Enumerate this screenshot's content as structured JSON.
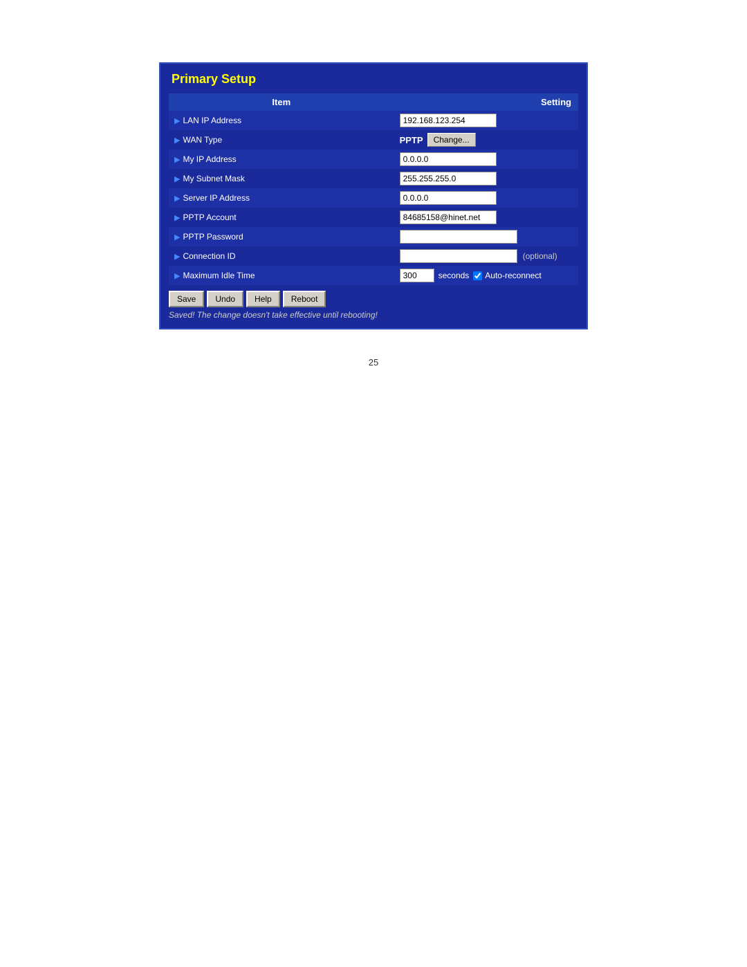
{
  "panel": {
    "title": "Primary Setup",
    "header": {
      "item_label": "Item",
      "setting_label": "Setting"
    },
    "rows": [
      {
        "label": "LAN IP Address",
        "arrow": "▶",
        "type": "input",
        "value": "192.168.123.254"
      },
      {
        "label": "WAN Type",
        "arrow": "▶",
        "type": "wan",
        "wan_value": "PPTP",
        "change_label": "Change..."
      },
      {
        "label": "My IP Address",
        "arrow": "▶",
        "type": "input",
        "value": "0.0.0.0"
      },
      {
        "label": "My Subnet Mask",
        "arrow": "▶",
        "type": "input",
        "value": "255.255.255.0"
      },
      {
        "label": "Server IP Address",
        "arrow": "▶",
        "type": "input",
        "value": "0.0.0.0"
      },
      {
        "label": "PPTP Account",
        "arrow": "▶",
        "type": "input",
        "value": "84685158@hinet.net"
      },
      {
        "label": "PPTP Password",
        "arrow": "▶",
        "type": "password",
        "value": ""
      },
      {
        "label": "Connection ID",
        "arrow": "▶",
        "type": "input_optional",
        "value": "",
        "optional_text": "(optional)"
      },
      {
        "label": "Maximum Idle Time",
        "arrow": "▶",
        "type": "idle",
        "value": "300",
        "seconds_label": "seconds",
        "auto_reconnect_label": "Auto-reconnect",
        "auto_reconnect_checked": true
      }
    ],
    "buttons": {
      "save": "Save",
      "undo": "Undo",
      "help": "Help",
      "reboot": "Reboot"
    },
    "status_message": "Saved! The change doesn't take effective until rebooting!"
  },
  "page_number": "25"
}
